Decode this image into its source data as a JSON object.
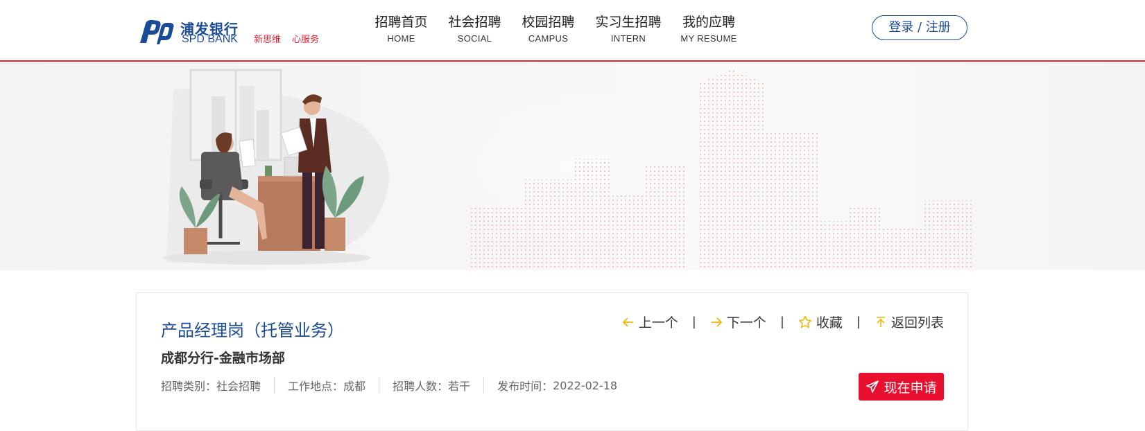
{
  "brand": {
    "name_cn": "浦发银行",
    "name_en": "SPD BANK",
    "slogan": [
      "新思维",
      "心服务"
    ],
    "color": "#1b4b98",
    "accent": "#e8202f"
  },
  "nav": [
    {
      "cn": "招聘首页",
      "en": "HOME"
    },
    {
      "cn": "社会招聘",
      "en": "SOCIAL"
    },
    {
      "cn": "校园招聘",
      "en": "CAMPUS"
    },
    {
      "cn": "实习生招聘",
      "en": "INTERN"
    },
    {
      "cn": "我的应聘",
      "en": "MY RESUME"
    }
  ],
  "login_label": "登录 / 注册",
  "job": {
    "title": "产品经理岗（托管业务）",
    "department": "成都分行-金融市场部",
    "meta": [
      {
        "label": "招聘类别：",
        "value": "社会招聘"
      },
      {
        "label": "工作地点：",
        "value": "成都"
      },
      {
        "label": "招聘人数：",
        "value": "若干"
      },
      {
        "label": "发布时间：",
        "value": "2022-02-18"
      }
    ]
  },
  "actions": {
    "prev": "上一个",
    "next": "下一个",
    "favorite": "收藏",
    "back": "返回列表",
    "separator": "|"
  },
  "apply_label": "现在申请",
  "icons": {
    "prev": "arrow-left-icon",
    "next": "arrow-right-icon",
    "favorite": "star-icon",
    "back": "arrow-up-icon",
    "apply": "paper-plane-icon"
  }
}
